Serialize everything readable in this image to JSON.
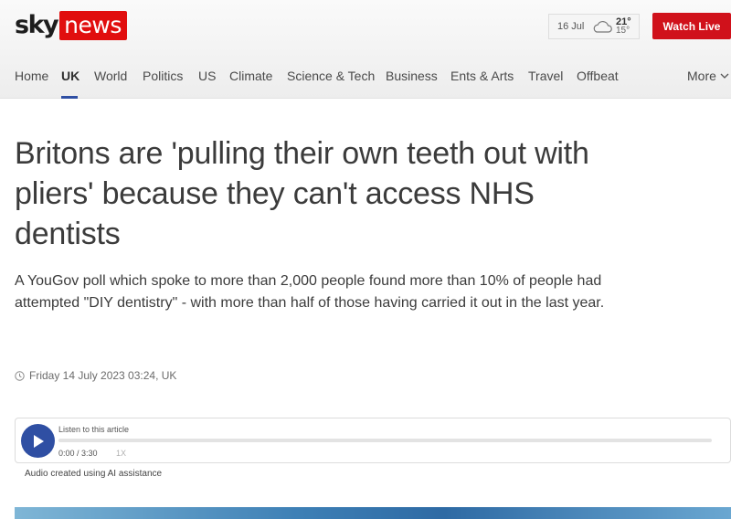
{
  "header": {
    "logo": {
      "sky": "sky",
      "news": "news"
    },
    "weather": {
      "date": "16 Jul",
      "icon": "cloud-icon",
      "high": "21°",
      "low": "15°"
    },
    "watch_live": "Watch Live"
  },
  "nav": {
    "items": [
      {
        "label": "Home"
      },
      {
        "label": "UK",
        "active": true
      },
      {
        "label": "World"
      },
      {
        "label": "Politics"
      },
      {
        "label": "US"
      },
      {
        "label": "Climate"
      },
      {
        "label": "Science & Tech"
      },
      {
        "label": "Business"
      },
      {
        "label": "Ents & Arts"
      },
      {
        "label": "Travel"
      },
      {
        "label": "Offbeat"
      }
    ],
    "more": "More"
  },
  "article": {
    "headline": "Britons are 'pulling their own teeth out with pliers' because they can't access NHS dentists",
    "standfirst": "A YouGov poll which spoke to more than 2,000 people found more than 10% of people had attempted \"DIY dentistry\" - with more than half of those having carried it out in the last year.",
    "timestamp": "Friday 14 July 2023 03:24, UK"
  },
  "audio": {
    "label": "Listen to this article",
    "time": "0:00 / 3:30",
    "speed": "1X",
    "progress": 0,
    "note": "Audio created using AI assistance"
  },
  "colors": {
    "brand_red": "#e10e0e",
    "accent_blue": "#2f4fa3",
    "watch_live_red": "#d0111b"
  }
}
